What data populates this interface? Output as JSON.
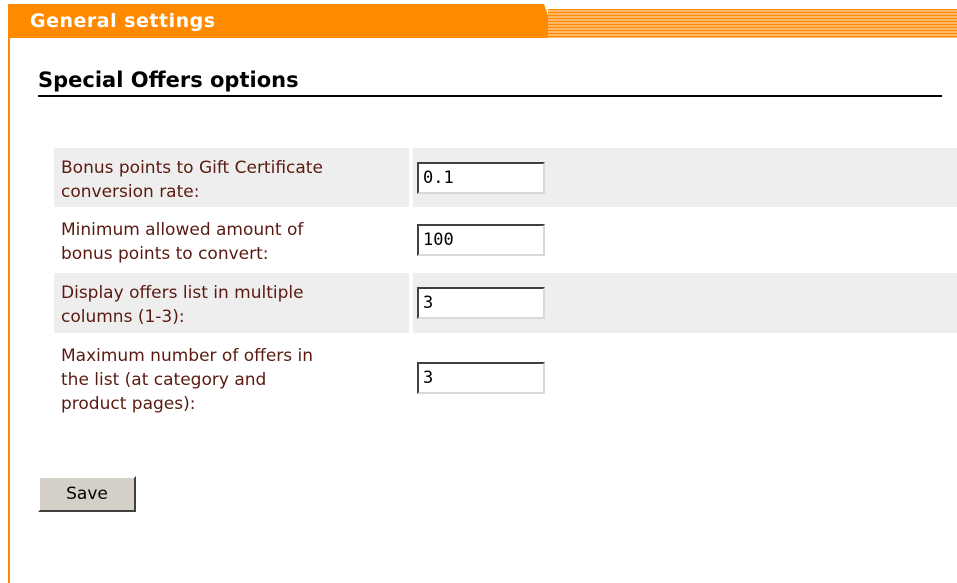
{
  "header": {
    "tab_title": "General settings"
  },
  "section": {
    "title": "Special Offers options"
  },
  "settings": [
    {
      "label_line1": "Bonus points to Gift Certificate",
      "label_line2": "conversion rate:",
      "value": "0.1"
    },
    {
      "label_line1": "Minimum allowed amount of",
      "label_line2": "bonus points to convert:",
      "value": "100"
    },
    {
      "label_line1": "Display offers list in multiple",
      "label_line2": "columns (1-3):",
      "value": "3"
    },
    {
      "label_line1": "Maximum number of offers in",
      "label_line2": "the list (at category and",
      "label_line3": "product pages):",
      "value": "3"
    }
  ],
  "actions": {
    "save_label": "Save"
  },
  "colors": {
    "accent": "#ff8a00",
    "label_text": "#5a1a10",
    "row_shade": "#eeeeee"
  }
}
